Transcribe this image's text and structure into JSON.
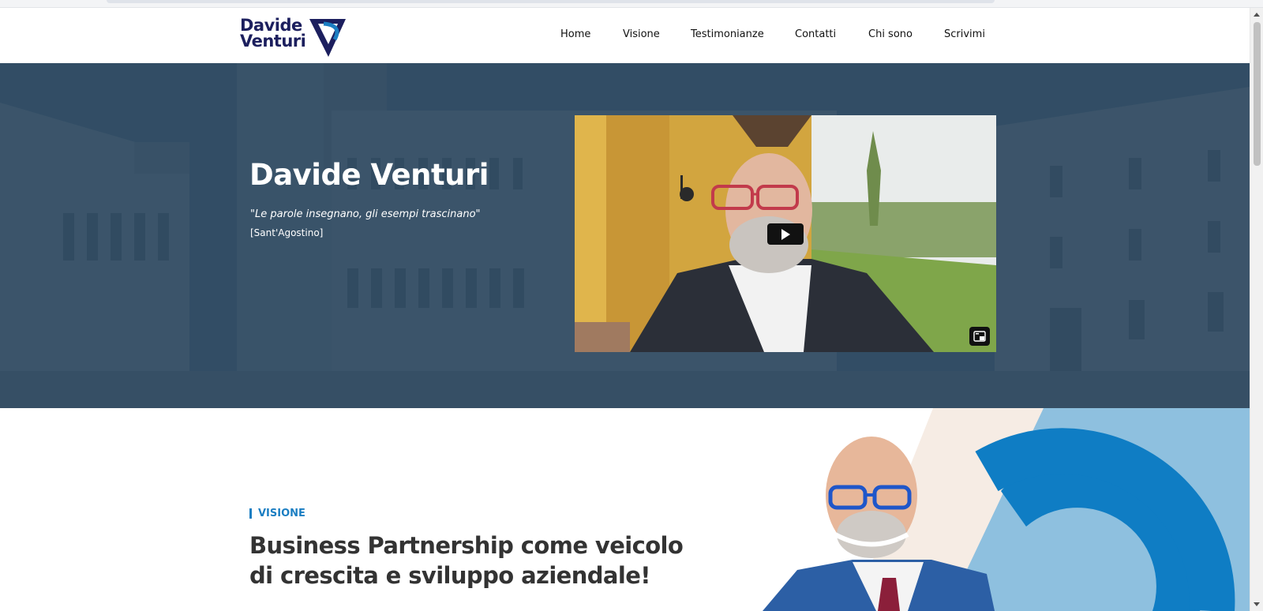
{
  "brand": {
    "logo_line1": "Davide",
    "logo_line2": "Venturi",
    "logo_icon": "dv-monogram-icon",
    "colors": {
      "navy": "#1c1f5e",
      "accent_blue": "#1b7ec2"
    }
  },
  "nav": {
    "items": [
      {
        "label": "Home"
      },
      {
        "label": "Visione"
      },
      {
        "label": "Testimonianze"
      },
      {
        "label": "Contatti"
      },
      {
        "label": "Chi sono"
      },
      {
        "label": "Scrivimi"
      }
    ]
  },
  "hero": {
    "title": "Davide Venturi",
    "quote": "\"Le parole insegnano, gli esempi trascinano\"",
    "author": "[Sant'Agostino]",
    "overlay_color": "#23415c",
    "video": {
      "play_icon": "play-icon",
      "pip_icon": "picture-in-picture-icon"
    }
  },
  "vision": {
    "label": "VISIONE",
    "heading_line1": "Business Partnership come veicolo",
    "heading_line2": "di crescita e sviluppo aziendale!"
  }
}
